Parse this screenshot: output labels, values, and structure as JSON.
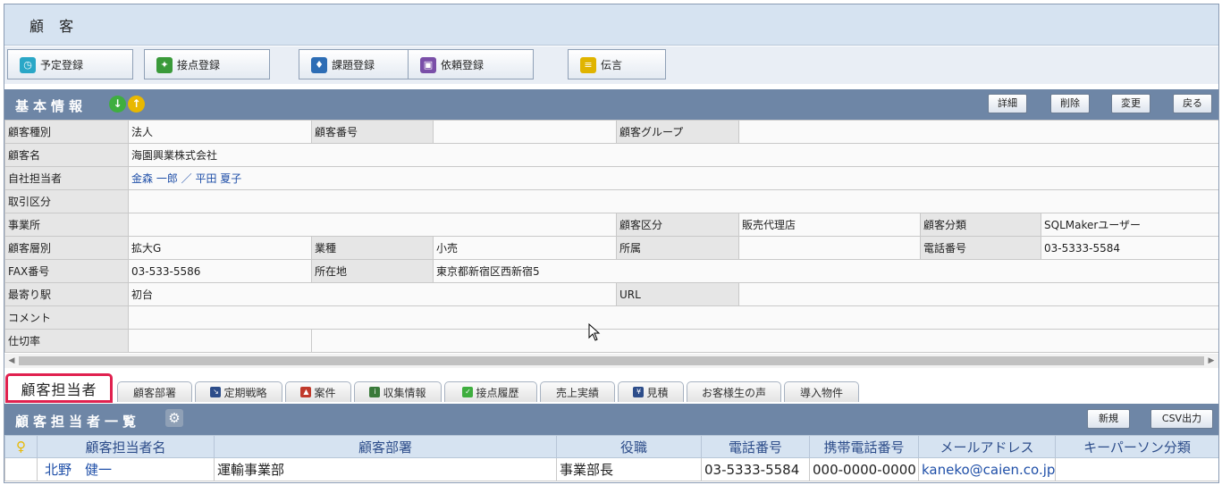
{
  "window": {
    "title": "顧 客"
  },
  "toolbar": [
    {
      "label": "予定登録",
      "icon": "clock-icon",
      "color": "#2aa7c7"
    },
    {
      "label": "接点登録",
      "icon": "handshake-icon",
      "color": "#3a9a3a"
    },
    {
      "label": "課題登録",
      "icon": "pushpin-icon",
      "color": "#2d6db5"
    },
    {
      "label": "依頼登録",
      "icon": "gift-icon",
      "color": "#7a4fa8"
    },
    {
      "label": "伝言",
      "icon": "note-icon",
      "color": "#e0b400"
    }
  ],
  "basic": {
    "title": "基本情報",
    "buttons": {
      "detail": "詳細",
      "delete": "削除",
      "edit": "変更",
      "back": "戻る"
    },
    "fields": {
      "customer_type_label": "顧客種別",
      "customer_type": "法人",
      "customer_no_label": "顧客番号",
      "customer_no": "",
      "customer_group_label": "顧客グループ",
      "customer_group": "",
      "customer_name_label": "顧客名",
      "customer_name": "海園興業株式会社",
      "staff_label": "自社担当者",
      "staff": "金森 一郎 ／ 平田 夏子",
      "transaction_label": "取引区分",
      "transaction": "",
      "office_label": "事業所",
      "office": "",
      "customer_category_label": "顧客区分",
      "customer_category": "販売代理店",
      "customer_class_label": "顧客分類",
      "customer_class": "SQLMakerユーザー",
      "customer_tier_label": "顧客層別",
      "customer_tier": "拡大G",
      "industry_label": "業種",
      "industry": "小売",
      "affiliation_label": "所属",
      "affiliation": "",
      "phone_label": "電話番号",
      "phone": "03-5333-5584",
      "fax_label": "FAX番号",
      "fax": "03-533-5586",
      "address_label": "所在地",
      "address": "東京都新宿区西新宿5",
      "station_label": "最寄り駅",
      "station": "初台",
      "url_label": "URL",
      "url": "",
      "comment_label": "コメント",
      "comment": "",
      "rate_label": "仕切率",
      "rate": ""
    }
  },
  "tabs": {
    "active": "顧客担当者",
    "items": [
      {
        "label": "顧客部署",
        "icon": ""
      },
      {
        "label": "定期戦略",
        "icon": "strategy-icon"
      },
      {
        "label": "案件",
        "icon": "case-icon"
      },
      {
        "label": "収集情報",
        "icon": "info-icon"
      },
      {
        "label": "接点履歴",
        "icon": "contact-history-icon"
      },
      {
        "label": "売上実績",
        "icon": ""
      },
      {
        "label": "見積",
        "icon": "estimate-icon"
      },
      {
        "label": "お客様生の声",
        "icon": ""
      },
      {
        "label": "導入物件",
        "icon": ""
      }
    ]
  },
  "list": {
    "title": "顧客担当者一覧",
    "new_label": "新規",
    "csv_label": "CSV出力",
    "columns": [
      "顧客担当者名",
      "顧客部署",
      "役職",
      "電話番号",
      "携帯電話番号",
      "メールアドレス",
      "キーパーソン分類"
    ],
    "rows": [
      {
        "name": "北野　健一",
        "dept": "運輸事業部",
        "role": "事業部長",
        "phone": "03-5333-5584",
        "mobile": "000-0000-0000",
        "email": "kaneko@caien.co.jp",
        "keyperson": ""
      }
    ]
  }
}
